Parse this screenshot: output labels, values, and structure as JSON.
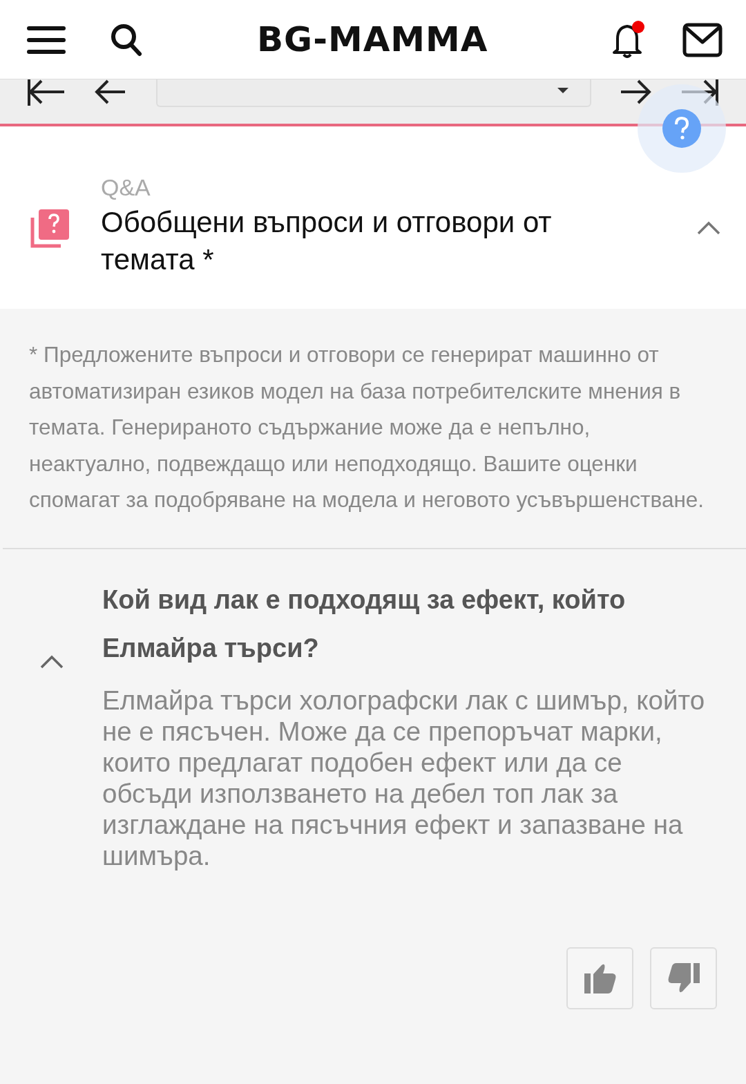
{
  "header": {
    "logo": "BG-MAMMA",
    "notifications_unread": true
  },
  "qa_section": {
    "label": "Q&A",
    "title": "Обобщени въпроси и отговори от темата *",
    "expanded": true
  },
  "disclaimer": "* Предложените въпроси и отговори се генерират машинно от автоматизиран езиков модел на база потребителските мнения в темата. Генерираното съдържание може да е непълно, неактуално, подвеждащо или неподходящо. Вашите оценки спомагат за подобряване на модела и неговото усъвършенстване.",
  "questions": [
    {
      "question": "Кой вид лак е подходящ за ефект, който Елмайра търси?",
      "answer": "Елмайра търси холографски лак с шимър, който не е пясъчен. Може да се препоръчат марки, които предлагат подобен ефект или да се обсъди използването на дебел топ лак за изглаждане на пясъчния ефект и запазване на шимъра.",
      "expanded": true
    }
  ]
}
